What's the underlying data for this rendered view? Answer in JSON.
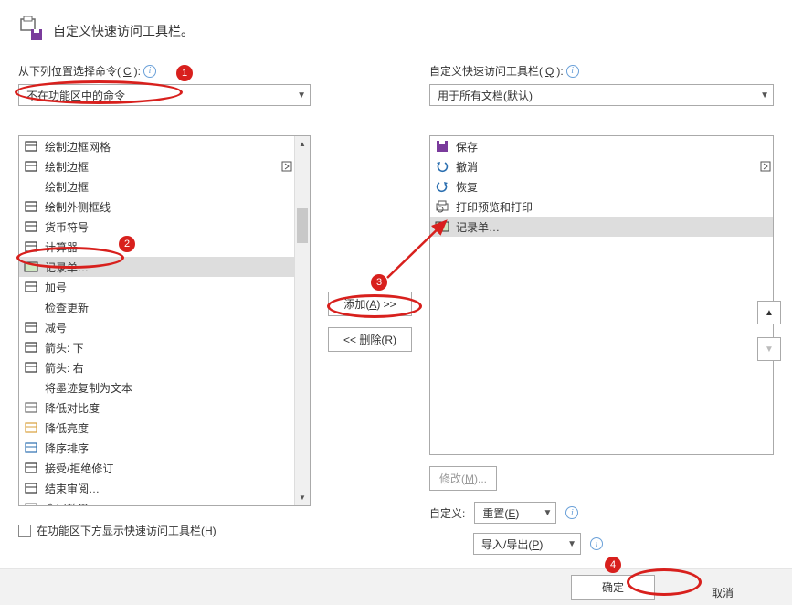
{
  "header": {
    "title": "自定义快速访问工具栏。"
  },
  "left": {
    "label_pre": "从下列位置选择命令(",
    "label_key": "C",
    "label_post": "):",
    "select": "不在功能区中的命令",
    "items": [
      {
        "name": "绘制边框网格",
        "iconFg": "#333",
        "iconBg": "",
        "ext": ""
      },
      {
        "name": "绘制边框",
        "iconFg": "#333",
        "iconBg": "",
        "ext": "sub"
      },
      {
        "name": "绘制边框",
        "iconFg": "",
        "iconBg": "",
        "ext": ""
      },
      {
        "name": "绘制外侧框线",
        "iconFg": "#333",
        "iconBg": "",
        "ext": ""
      },
      {
        "name": "货币符号",
        "iconFg": "#333",
        "iconBg": "",
        "ext": ""
      },
      {
        "name": "计算器",
        "iconFg": "#333",
        "iconBg": "",
        "ext": ""
      },
      {
        "name": "记录单…",
        "iconFg": "#333",
        "iconBg": "#cfe7c2",
        "ext": "",
        "sel": true
      },
      {
        "name": "加号",
        "iconFg": "#333",
        "iconBg": "",
        "ext": ""
      },
      {
        "name": "检查更新",
        "iconFg": "",
        "iconBg": "",
        "ext": ""
      },
      {
        "name": "减号",
        "iconFg": "#333",
        "iconBg": "",
        "ext": ""
      },
      {
        "name": "箭头: 下",
        "iconFg": "#333",
        "iconBg": "",
        "ext": ""
      },
      {
        "name": "箭头: 右",
        "iconFg": "#333",
        "iconBg": "",
        "ext": ""
      },
      {
        "name": "将墨迹复制为文本",
        "iconFg": "",
        "iconBg": "",
        "ext": ""
      },
      {
        "name": "降低对比度",
        "iconFg": "#6a6a6a",
        "iconBg": "",
        "ext": ""
      },
      {
        "name": "降低亮度",
        "iconFg": "#d9a03b",
        "iconBg": "",
        "ext": ""
      },
      {
        "name": "降序排序",
        "iconFg": "#2b6fb0",
        "iconBg": "",
        "ext": ""
      },
      {
        "name": "接受/拒绝修订",
        "iconFg": "#333",
        "iconBg": "",
        "ext": ""
      },
      {
        "name": "结束审阅…",
        "iconFg": "#333",
        "iconBg": "",
        "ext": ""
      },
      {
        "name": "金属效果",
        "iconFg": "#888",
        "iconBg": "",
        "ext": ""
      }
    ]
  },
  "mid": {
    "add_pre": "添加(",
    "add_key": "A",
    "add_post": ") >>",
    "remove_pre": "<< 删除(",
    "remove_key": "R",
    "remove_post": ")"
  },
  "right": {
    "label_pre": "自定义快速访问工具栏(",
    "label_key": "Q",
    "label_post": "):",
    "select": "用于所有文档(默认)",
    "items": [
      {
        "name": "保存",
        "iconFg": "#7a3b9c",
        "ext": ""
      },
      {
        "name": "撤消",
        "iconFg": "#2b6fb0",
        "ext": "sub"
      },
      {
        "name": "恢复",
        "iconFg": "#2b6fb0",
        "ext": ""
      },
      {
        "name": "打印预览和打印",
        "iconFg": "#555",
        "ext": ""
      },
      {
        "name": "记录单…",
        "iconFg": "#333",
        "ext": "",
        "sel": true
      }
    ],
    "modify_pre": "修改(",
    "modify_key": "M",
    "modify_post": ")...",
    "custom_label": "自定义:",
    "reset_pre": "重置(",
    "reset_key": "E",
    "reset_post": ")",
    "impexp_pre": "导入/导出(",
    "impexp_key": "P",
    "impexp_post": ")"
  },
  "checkbox_pre": "在功能区下方显示快速访问工具栏(",
  "checkbox_key": "H",
  "checkbox_post": ")",
  "footer": {
    "ok": "确定",
    "cancel": "取消"
  },
  "ann": {
    "n1": "1",
    "n2": "2",
    "n3": "3",
    "n4": "4"
  }
}
